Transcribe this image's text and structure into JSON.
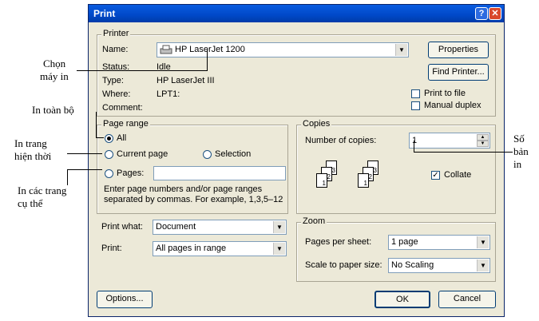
{
  "dialog": {
    "title": "Print",
    "help_glyph": "?",
    "close_glyph": "✕"
  },
  "printer": {
    "group_label": "Printer",
    "name_label": "Name:",
    "name_value": "HP LaserJet 1200",
    "status_label": "Status:",
    "status_value": "Idle",
    "type_label": "Type:",
    "type_value": "HP LaserJet III",
    "where_label": "Where:",
    "where_value": "LPT1:",
    "comment_label": "Comment:",
    "comment_value": "",
    "properties_button": "Properties",
    "find_printer_button": "Find Printer...",
    "print_to_file_label": "Print to file",
    "print_to_file_checked": false,
    "manual_duplex_label": "Manual duplex",
    "manual_duplex_checked": false
  },
  "page_range": {
    "group_label": "Page range",
    "all_label": "All",
    "current_page_label": "Current page",
    "selection_label": "Selection",
    "pages_label": "Pages:",
    "pages_value": "",
    "selected": "All",
    "hint": "Enter page numbers and/or page ranges separated by commas.  For example, 1,3,5–12"
  },
  "copies": {
    "group_label": "Copies",
    "number_label": "Number of copies:",
    "number_value": "1",
    "collate_label": "Collate",
    "collate_checked": true,
    "page_numbers": [
      "3",
      "2",
      "1"
    ]
  },
  "print_what": {
    "label": "Print what:",
    "value": "Document"
  },
  "print": {
    "label": "Print:",
    "value": "All pages in range"
  },
  "zoom": {
    "group_label": "Zoom",
    "pages_per_sheet_label": "Pages per sheet:",
    "pages_per_sheet_value": "1 page",
    "scale_label": "Scale to paper size:",
    "scale_value": "No Scaling"
  },
  "buttons": {
    "options": "Options...",
    "ok": "OK",
    "cancel": "Cancel"
  },
  "annotations": {
    "chon_may_in": [
      "Chọn",
      "máy in"
    ],
    "in_toan_bo": "In toàn bộ",
    "in_trang_hien_thoi": [
      "In trang",
      "hiện thời"
    ],
    "in_cac_trang_cu_the": [
      "In các trang",
      "cụ thể"
    ],
    "so_ban_in": [
      "Số",
      "bản",
      "in"
    ]
  },
  "colors": {
    "titlebar": "#0054e3",
    "dialog_bg": "#ece9d8"
  }
}
